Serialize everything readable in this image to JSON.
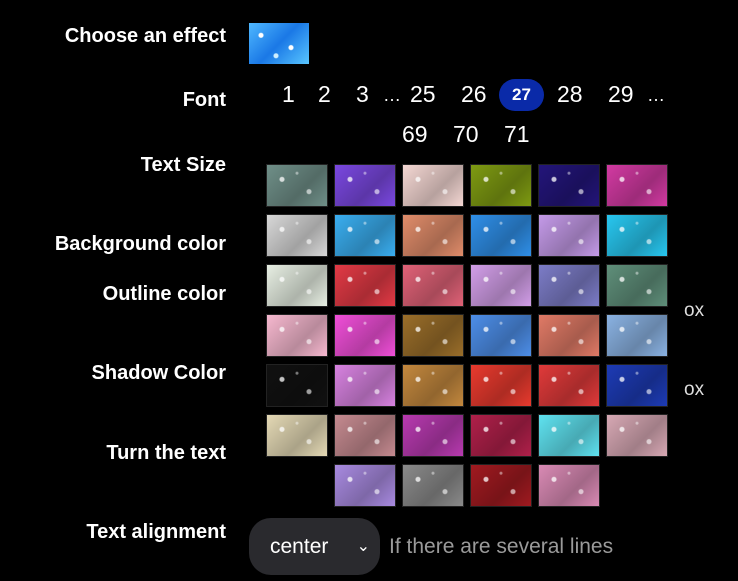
{
  "labels": {
    "effect": "Choose an effect",
    "font": "Font",
    "text_size": "Text Size",
    "background": "Background color",
    "outline": "Outline color",
    "shadow": "Shadow Color",
    "turn": "Turn the text",
    "alignment": "Text alignment"
  },
  "font_pager": {
    "row1": [
      "1",
      "2",
      "3",
      "…",
      "25",
      "26",
      "27",
      "28",
      "29",
      "…"
    ],
    "row2": [
      "69",
      "70",
      "71"
    ],
    "current": "27"
  },
  "clipped_text": [
    "ox",
    "ox"
  ],
  "alignment": {
    "selected": "center",
    "hint": "If there are several lines"
  },
  "effects": [
    [
      "#6f8f88",
      "#7a48e0",
      "#f4d7d3",
      "#7e9a12",
      "#23157a",
      "#d23aa2"
    ],
    [
      "#d8d8d8",
      "#3aaef0",
      "#e08c6a",
      "#2f8fe8",
      "#c49ae8",
      "#28c7f0"
    ],
    [
      "#e7efe3",
      "#e23a45",
      "#e06277",
      "#d29ee8",
      "#7c7cc7",
      "#5f8f7a"
    ],
    [
      "#f6b8cf",
      "#f04fd8",
      "#9a6e2a",
      "#4d8ee8",
      "#e07a66",
      "#8ab2e2"
    ],
    [
      "#111111",
      "#d782e0",
      "#c3883e",
      "#e83a2e",
      "#e03a3a",
      "#1d3bb5"
    ],
    [
      "#e4d9b5",
      "#c58a90",
      "#b83ab0",
      "#b0204a",
      "#5fe2f0",
      "#d7a8b4"
    ],
    [
      "",
      "#a88ae0",
      "#8a8a8a",
      "#a01a20",
      "#d98ab4",
      ""
    ]
  ]
}
